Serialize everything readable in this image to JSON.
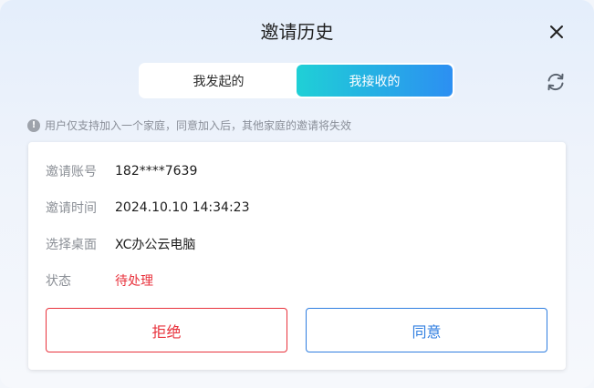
{
  "dialog": {
    "title": "邀请历史"
  },
  "tabs": [
    {
      "label": "我发起的",
      "active": false
    },
    {
      "label": "我接收的",
      "active": true
    }
  ],
  "notice": {
    "text": "用户仅支持加入一个家庭，同意加入后，其他家庭的邀请将失效"
  },
  "invitation": {
    "fields": [
      {
        "label": "邀请账号",
        "value": "182****7639"
      },
      {
        "label": "邀请时间",
        "value": "2024.10.10 14:34:23"
      },
      {
        "label": "选择桌面",
        "value": "XC办公云电脑"
      },
      {
        "label": "状态",
        "value": "待处理"
      }
    ],
    "reject_label": "拒绝",
    "accept_label": "同意"
  },
  "colors": {
    "accent": "#2c8ff2",
    "tab_gradient_start": "#1fd0d6",
    "pending": "#e8323c",
    "reject": "#e8323c",
    "accept": "#2f7ee0"
  },
  "icons": {
    "close": "close-icon",
    "refresh": "refresh-icon",
    "info": "info-icon"
  }
}
